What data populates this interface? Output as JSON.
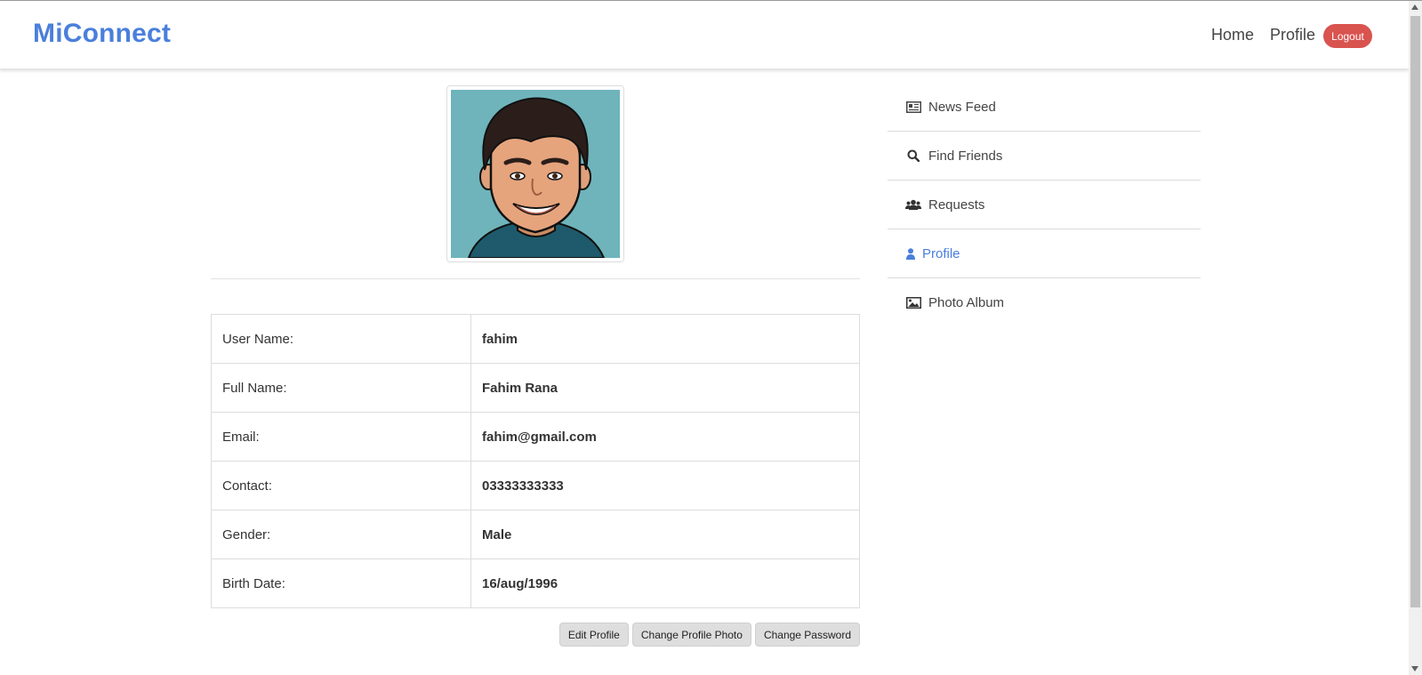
{
  "navbar": {
    "brand": "MiConnect",
    "links": [
      "Home",
      "Profile"
    ],
    "logout_label": "Logout",
    "brand_color": "#4a7fdc",
    "logout_color": "#d9534f"
  },
  "profile": {
    "avatar_alt": "profile-photo",
    "rows": [
      {
        "label": "User Name:",
        "value": "fahim"
      },
      {
        "label": "Full Name:",
        "value": "Fahim Rana"
      },
      {
        "label": "Email:",
        "value": "fahim@gmail.com"
      },
      {
        "label": "Contact:",
        "value": "03333333333"
      },
      {
        "label": "Gender:",
        "value": "Male"
      },
      {
        "label": "Birth Date:",
        "value": "16/aug/1996"
      }
    ],
    "buttons": [
      "Edit Profile",
      "Change Profile Photo",
      "Change Password"
    ]
  },
  "sidebar": {
    "items": [
      {
        "label": "News Feed",
        "icon": "newspaper-icon"
      },
      {
        "label": "Find Friends",
        "icon": "search-icon"
      },
      {
        "label": "Requests",
        "icon": "users-icon"
      },
      {
        "label": "Profile",
        "icon": "user-icon",
        "active": true
      },
      {
        "label": "Photo Album",
        "icon": "image-icon"
      }
    ],
    "active_color": "#4a7fdc"
  }
}
